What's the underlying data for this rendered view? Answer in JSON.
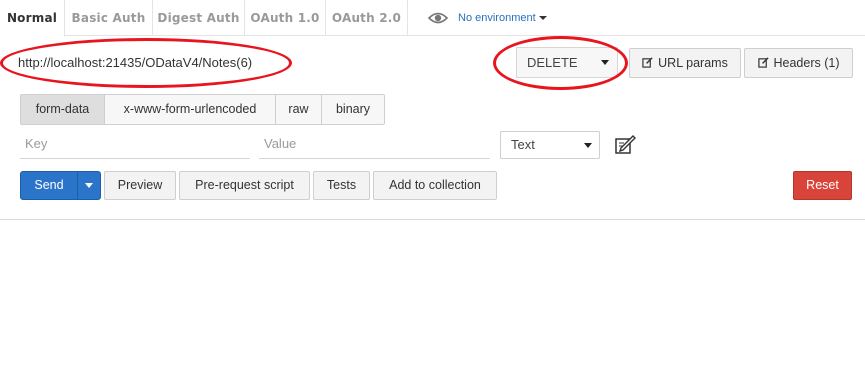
{
  "auth_tabs": [
    "Normal",
    "Basic Auth",
    "Digest Auth",
    "OAuth 1.0",
    "OAuth 2.0"
  ],
  "auth_tabs_active": "Normal",
  "environment": {
    "label": "No environment",
    "icon": "eye-icon"
  },
  "request": {
    "url": "http://localhost:21435/ODataV4/Notes(6)",
    "method": "DELETE",
    "url_params_label": "URL params",
    "headers_label": "Headers (1)"
  },
  "body_types": [
    "form-data",
    "x-www-form-urlencoded",
    "raw",
    "binary"
  ],
  "body_types_active": "form-data",
  "form_row": {
    "key_placeholder": "Key",
    "value_placeholder": "Value",
    "type_value": "Text"
  },
  "actions": {
    "send": "Send",
    "preview": "Preview",
    "pre_request_script": "Pre-request script",
    "tests": "Tests",
    "add_to_collection": "Add to collection",
    "reset": "Reset"
  },
  "colors": {
    "send": "#2a74c9",
    "reset": "#d9443a",
    "annotation": "#e8151f",
    "environment_link": "#2a6fbf"
  }
}
